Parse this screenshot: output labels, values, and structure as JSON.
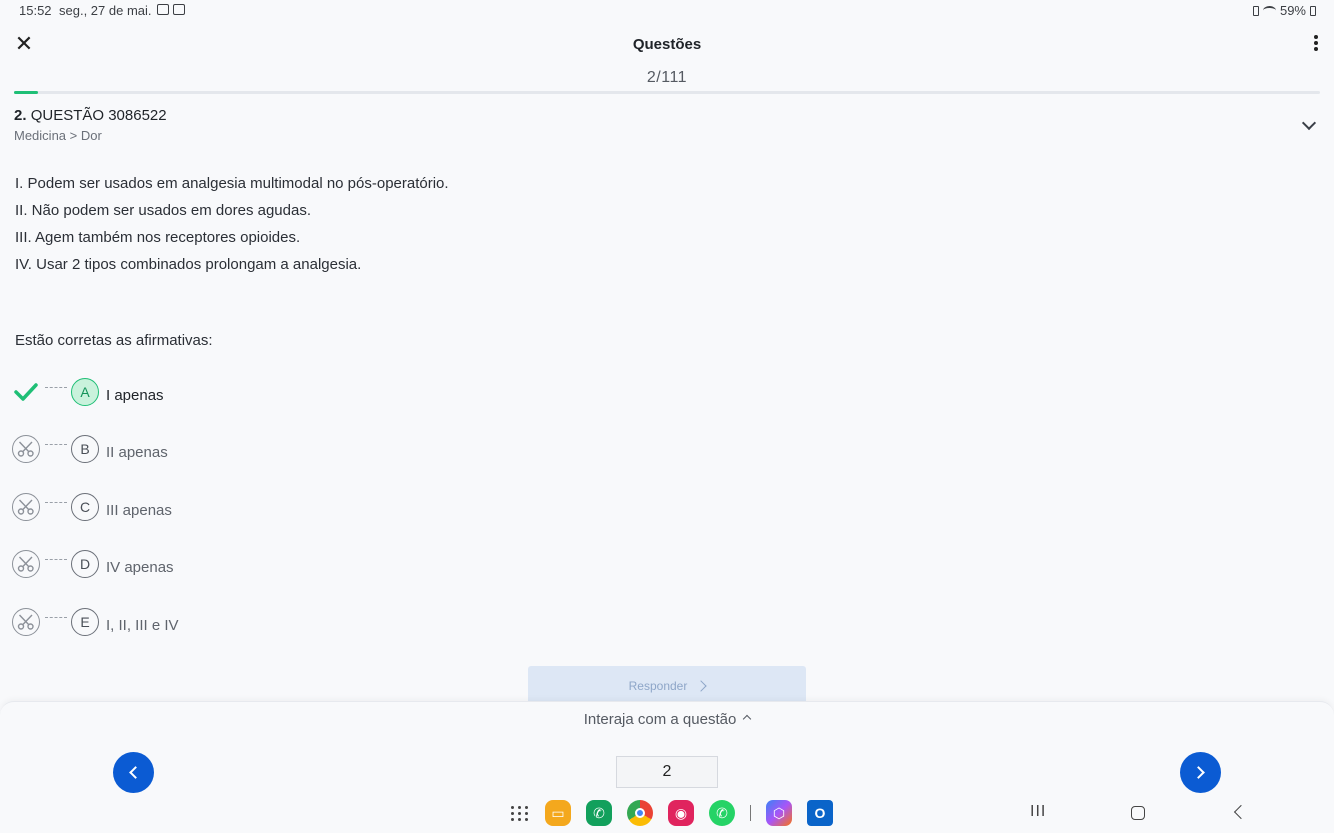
{
  "status_bar": {
    "time": "15:52",
    "date": "seg., 27 de mai.",
    "battery": "59%"
  },
  "header": {
    "title": "Questões",
    "counter": "2/111",
    "progress_fraction": 0.018
  },
  "question": {
    "number": "2.",
    "title": "QUESTÃO 3086522",
    "breadcrumb": "Medicina > Dor",
    "statements": [
      "I. Podem ser usados em analgesia multimodal no pós-operatório.",
      "II. Não podem ser usados em dores agudas.",
      "III. Agem também nos receptores opioides.",
      "IV. Usar 2 tipos combinados prolongam a analgesia."
    ],
    "prompt": "Estão corretas as afirmativas:",
    "options": [
      {
        "letter": "A",
        "text": "I apenas",
        "selected": true
      },
      {
        "letter": "B",
        "text": "II apenas",
        "selected": false
      },
      {
        "letter": "C",
        "text": "III apenas",
        "selected": false
      },
      {
        "letter": "D",
        "text": "IV apenas",
        "selected": false
      },
      {
        "letter": "E",
        "text": "I, II, III e IV",
        "selected": false
      }
    ]
  },
  "actions": {
    "submit_label": "Responder",
    "interact_label": "Interaja com a questão",
    "page_value": "2"
  },
  "colors": {
    "accent_blue": "#0b5bd3",
    "success_green": "#1fbf76",
    "submit_bg": "#dde7f5"
  },
  "dock_apps": [
    {
      "name": "my-files",
      "color": "#f4a81d"
    },
    {
      "name": "phone",
      "color": "#12a05c"
    },
    {
      "name": "chrome",
      "color": "#ffffff"
    },
    {
      "name": "screen-recorder",
      "color": "#e0245e"
    },
    {
      "name": "whatsapp",
      "color": "#25d366"
    },
    {
      "name": "copilot",
      "color": "#ffffff"
    },
    {
      "name": "outlook",
      "color": "#0a64c9"
    }
  ]
}
